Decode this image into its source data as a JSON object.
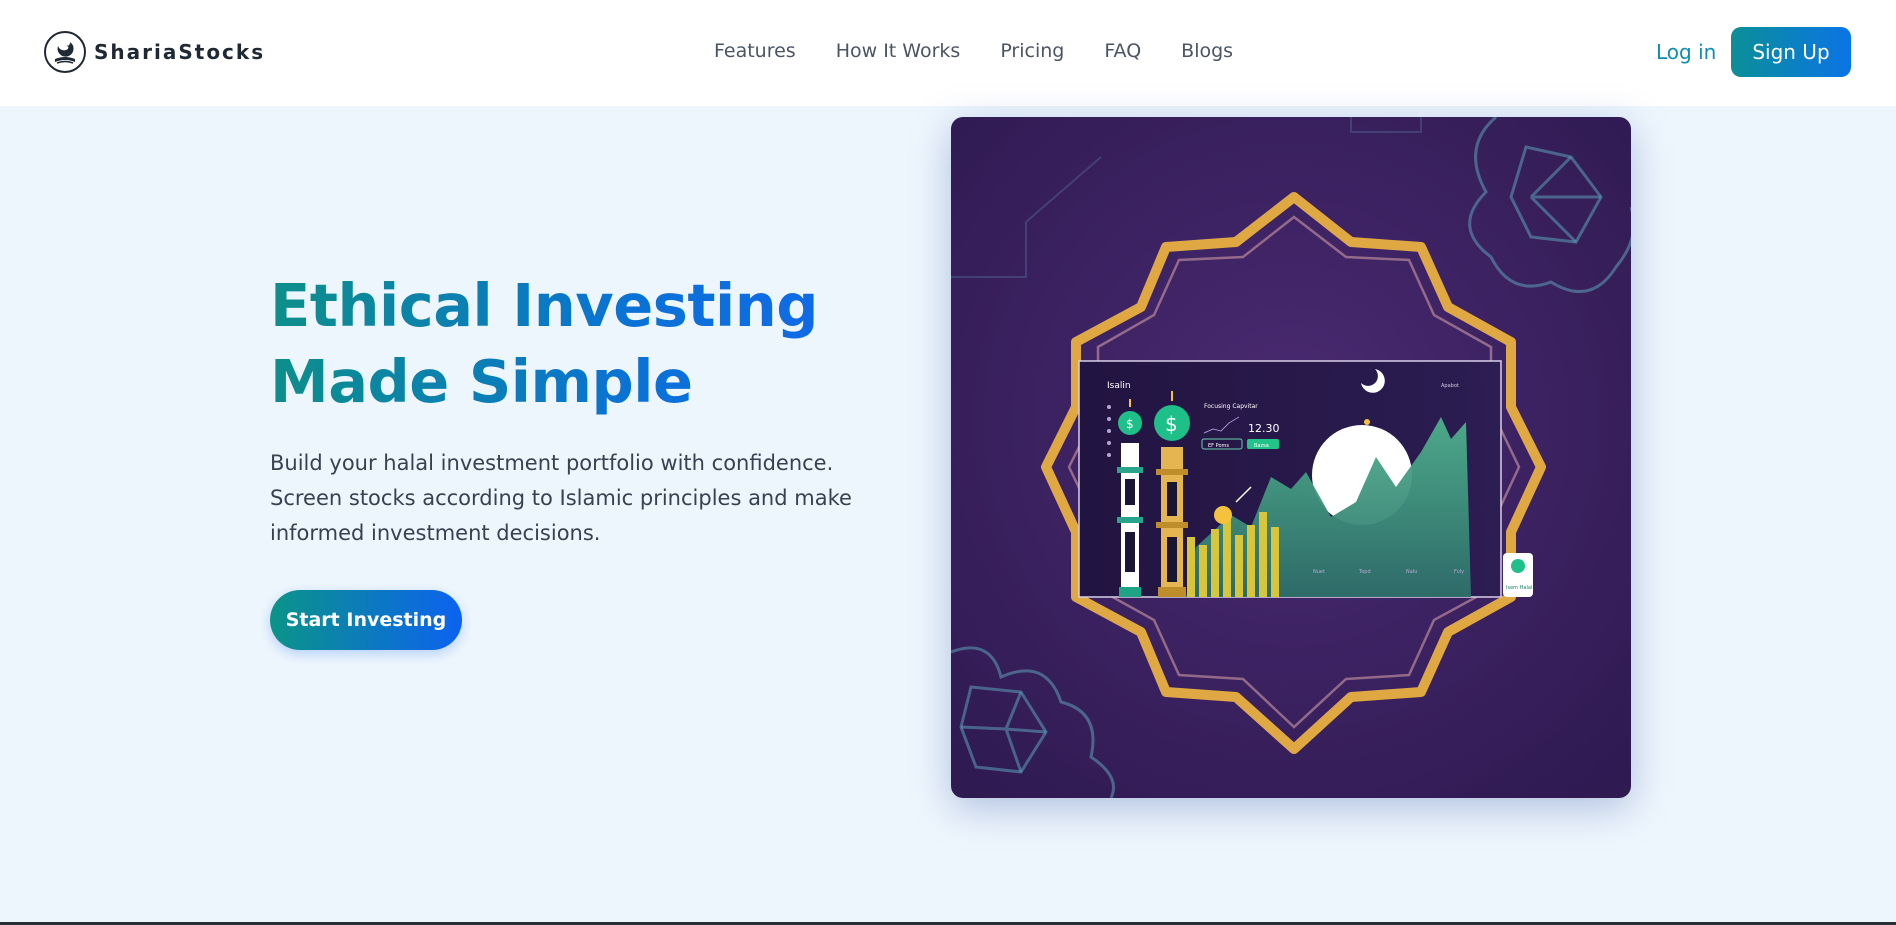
{
  "brand": {
    "name": "ShariaStocks",
    "logo_icon": "crescent-mosque-logo-icon"
  },
  "nav": {
    "items": [
      {
        "label": "Features"
      },
      {
        "label": "How It Works"
      },
      {
        "label": "Pricing"
      },
      {
        "label": "FAQ"
      },
      {
        "label": "Blogs"
      }
    ],
    "login_label": "Log in",
    "signup_label": "Sign Up"
  },
  "hero": {
    "title": "Ethical Investing Made Simple",
    "subtitle": "Build your halal investment portfolio with confidence. Screen stocks according to Islamic principles and make informed investment decisions.",
    "cta_label": "Start Investing"
  },
  "illustration": {
    "screen_title": "Isalin",
    "screen_subtitle": "Focusing Capvitar",
    "screen_value": "12.30",
    "screen_button_1": "EF Poms",
    "screen_button_2": "Bazsa",
    "screen_top_right": "Apabot",
    "x_labels": [
      "Nuet",
      "Tepd",
      "Nalu",
      "Fuly"
    ],
    "badge_label": "Isem Halal"
  },
  "colors": {
    "accent_teal": "#0b8f97",
    "accent_blue": "#0b74e6",
    "page_bg": "#eef6fd",
    "illustration_bg": "#3a1f5c",
    "frame_gold": "#e0a843"
  }
}
